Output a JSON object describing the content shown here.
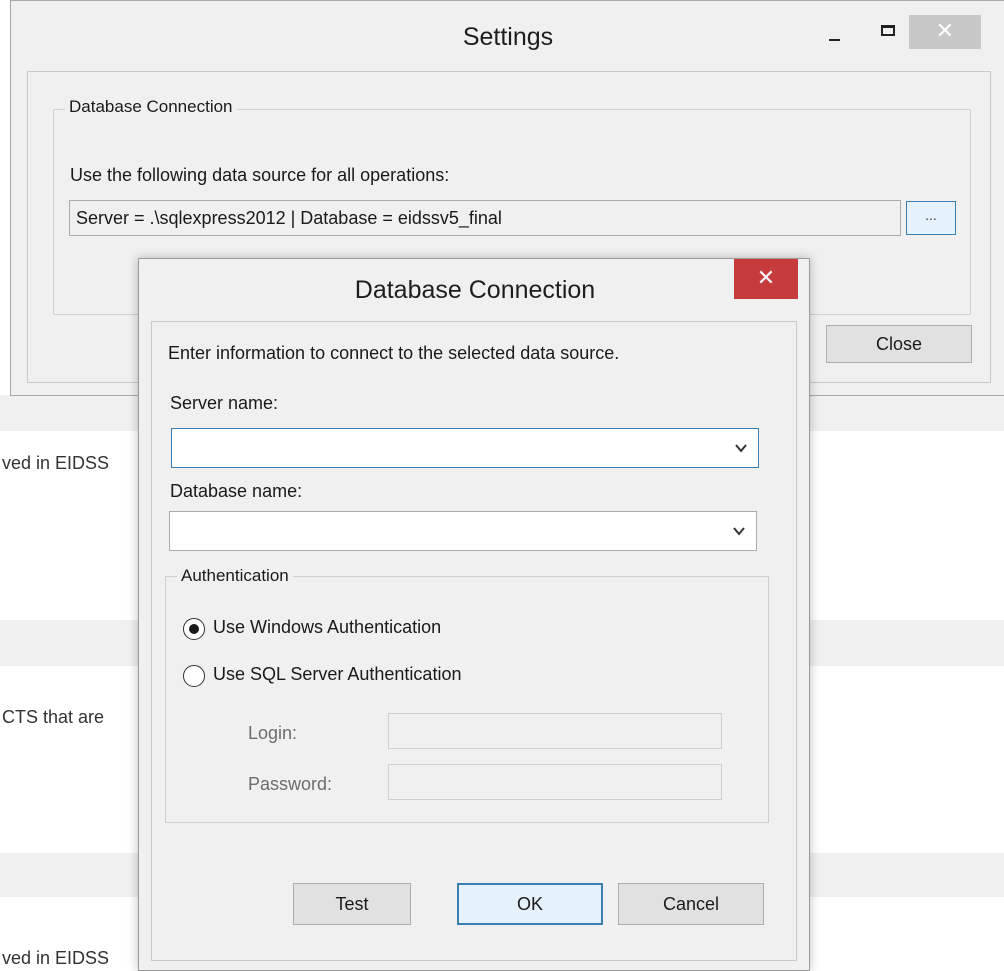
{
  "background": {
    "snippets": [
      "ved in EIDSS",
      "CTS that are",
      "ved in EIDSS"
    ]
  },
  "settings_window": {
    "title": "Settings",
    "controls": {
      "minimize": "minimize",
      "maximize": "maximize",
      "close": "✕"
    },
    "group": {
      "legend": "Database Connection",
      "description": "Use the following data source for all operations:",
      "data_source_value": "Server = .\\sqlexpress2012 | Database = eidssv5_final",
      "browse_label": "..."
    },
    "close_button": "Close"
  },
  "dialog": {
    "title": "Database Connection",
    "close_glyph": "✕",
    "intro": "Enter information to connect to the selected data source.",
    "server_label": "Server name:",
    "server_value": "",
    "database_label": "Database name:",
    "database_value": "",
    "auth": {
      "legend": "Authentication",
      "options": [
        {
          "label": "Use Windows Authentication",
          "selected": true
        },
        {
          "label": "Use SQL Server Authentication",
          "selected": false
        }
      ],
      "login_label": "Login:",
      "password_label": "Password:"
    },
    "buttons": {
      "test": "Test",
      "ok": "OK",
      "cancel": "Cancel"
    }
  },
  "colors": {
    "window_bg": "#f0f0f0",
    "dialog_close_red": "#c63c3c",
    "focus_blue": "#3c7fb1"
  }
}
